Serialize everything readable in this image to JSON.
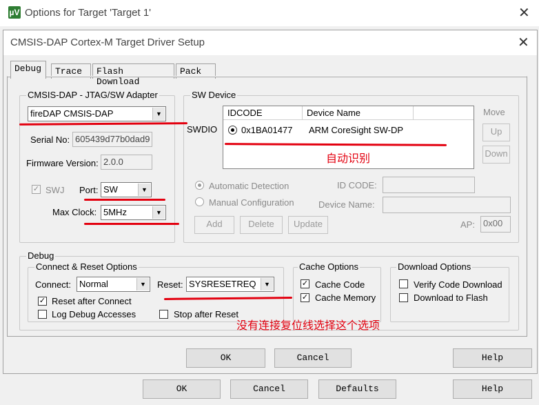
{
  "outer_window": {
    "title": "Options for Target 'Target 1'",
    "icon": "µV",
    "close": "✕"
  },
  "dialog": {
    "title": "CMSIS-DAP Cortex-M Target Driver Setup",
    "close": "✕"
  },
  "tabs": [
    {
      "label": "Debug"
    },
    {
      "label": "Trace"
    },
    {
      "label": "Flash Download"
    },
    {
      "label": "Pack"
    }
  ],
  "adapter": {
    "group_label": "CMSIS-DAP - JTAG/SW Adapter",
    "adapter_value": "fireDAP CMSIS-DAP",
    "serial_label": "Serial No:",
    "serial_value": "605439d77b0dad9",
    "firmware_label": "Firmware Version:",
    "firmware_value": "2.0.0",
    "swj_label": "SWJ",
    "port_label": "Port:",
    "port_value": "SW",
    "maxclock_label": "Max Clock:",
    "maxclock_value": "5MHz"
  },
  "swdevice": {
    "group_label": "SW Device",
    "swdio_label": "SWDIO",
    "col_idcode": "IDCODE",
    "col_devname": "Device Name",
    "row": {
      "idcode": "0x1BA01477",
      "device": "ARM CoreSight SW-DP"
    },
    "move_label": "Move",
    "up_label": "Up",
    "down_label": "Down",
    "auto_detect": "Automatic Detection",
    "manual_config": "Manual Configuration",
    "idcode_label": "ID CODE:",
    "devname_label": "Device Name:",
    "add_label": "Add",
    "delete_label": "Delete",
    "update_label": "Update",
    "ap_label": "AP:",
    "ap_value": "0x00"
  },
  "debug": {
    "group_label": "Debug",
    "cr_group_label": "Connect & Reset Options",
    "connect_label": "Connect:",
    "connect_value": "Normal",
    "reset_label": "Reset:",
    "reset_value": "SYSRESETREQ",
    "reset_after_connect": "Reset after Connect",
    "log_debug": "Log Debug Accesses",
    "stop_after_reset": "Stop after Reset",
    "cache_group_label": "Cache Options",
    "cache_code": "Cache Code",
    "cache_memory": "Cache Memory",
    "download_group_label": "Download Options",
    "verify_code": "Verify Code Download",
    "download_flash": "Download to Flash"
  },
  "dialog_buttons": {
    "ok": "OK",
    "cancel": "Cancel",
    "help": "Help"
  },
  "outer_buttons": {
    "ok": "OK",
    "cancel": "Cancel",
    "defaults": "Defaults",
    "help": "Help"
  },
  "annotations": {
    "auto_detect_note": "自动识别",
    "reset_note": "没有连接复位线选择这个选项",
    "color": "#e3000f"
  }
}
